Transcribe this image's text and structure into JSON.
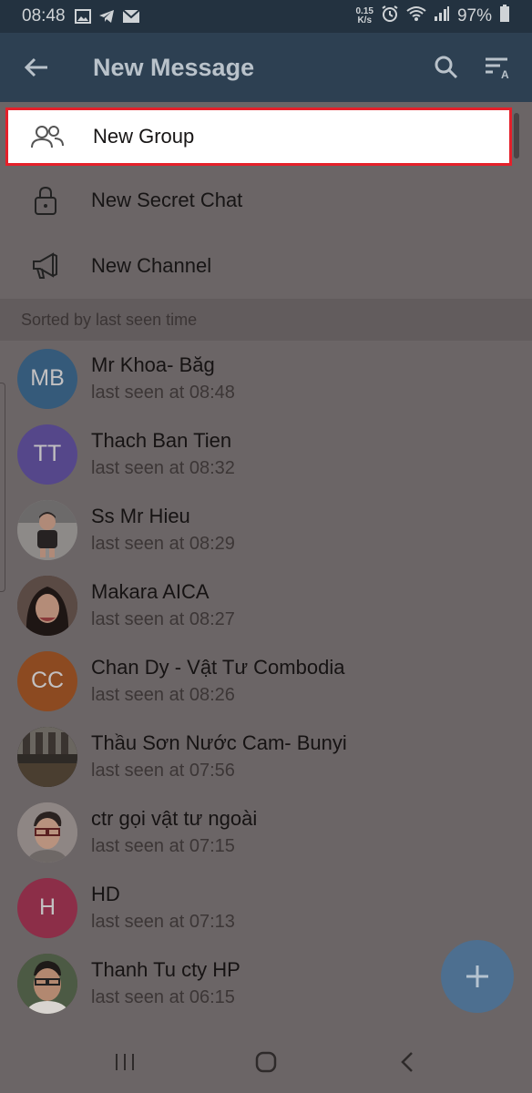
{
  "status_bar": {
    "time": "08:48",
    "net_speed_top": "0.15",
    "net_speed_bottom": "K/s",
    "battery": "97%"
  },
  "app_bar": {
    "title": "New Message"
  },
  "menu": [
    {
      "label": "New Group",
      "icon": "group-icon",
      "highlighted": true
    },
    {
      "label": "New Secret Chat",
      "icon": "lock-icon"
    },
    {
      "label": "New Channel",
      "icon": "megaphone-icon"
    }
  ],
  "section_header": "Sorted by last seen time",
  "contacts": [
    {
      "name": "Mr Khoa- Băg",
      "status": "last seen at 08:48",
      "initials": "MB",
      "color": "#355a7a"
    },
    {
      "name": "Thach Ban Tien",
      "status": "last seen at 08:32",
      "initials": "TT",
      "color": "#55478a"
    },
    {
      "name": "Ss Mr Hieu",
      "status": "last seen at 08:29",
      "initials": "",
      "color": "#7c7a7a"
    },
    {
      "name": "Makara AICA",
      "status": "last seen at 08:27",
      "initials": "",
      "color": "#4a3432"
    },
    {
      "name": "Chan Dy - Vật Tư Combodia",
      "status": "last seen at 08:26",
      "initials": "CC",
      "color": "#8c4a21"
    },
    {
      "name": "Thầu Sơn Nước Cam- Bunyi",
      "status": "last seen at 07:56",
      "initials": "",
      "color": "#3d3530"
    },
    {
      "name": "ctr gọi vật tư ngoài",
      "status": "last seen at 07:15",
      "initials": "",
      "color": "#8a8080"
    },
    {
      "name": "HD",
      "status": "last seen at 07:13",
      "initials": "H",
      "color": "#8c2e48"
    },
    {
      "name": "Thanh Tu cty HP",
      "status": "last seen at 06:15",
      "initials": "",
      "color": "#5b4a3c"
    }
  ],
  "colors": {
    "app_bar": "#2d4052",
    "highlight_border": "#e5202a",
    "fab": "#4d6f90"
  }
}
